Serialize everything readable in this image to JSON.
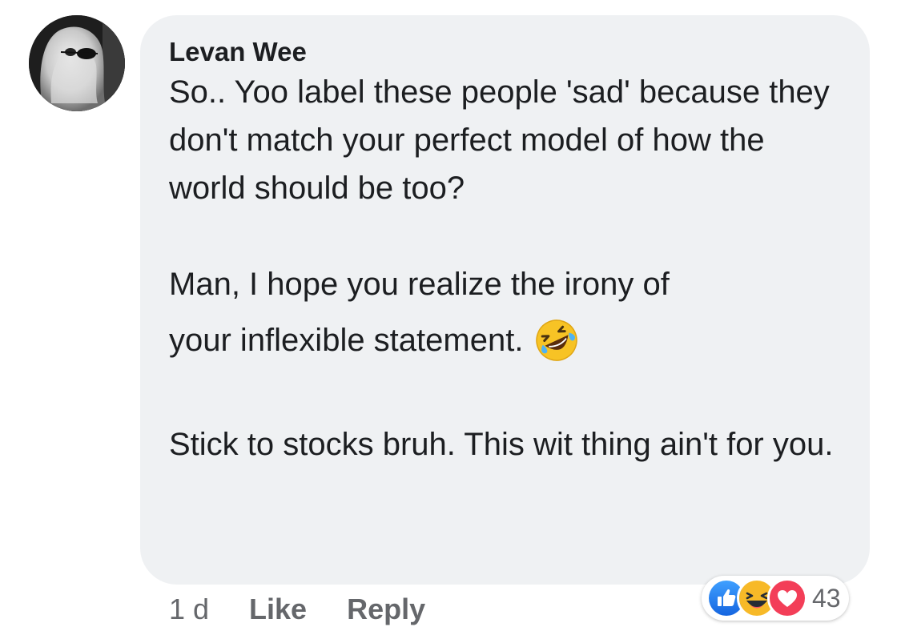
{
  "comment": {
    "author": "Levan Wee",
    "paragraphs": [
      "So.. Yoo label these people 'sad' because they don't match your perfect model of how the world should be too?",
      "Man, I hope you realize the irony of",
      "your inflexible statement.",
      "Stick to stocks bruh. This wit thing ain't for you."
    ],
    "emoji": "rolling-on-floor-laughing-icon"
  },
  "actions": {
    "time": "1 d",
    "like": "Like",
    "reply": "Reply"
  },
  "reactions": {
    "icons": [
      "like-reaction-icon",
      "haha-reaction-icon",
      "love-reaction-icon"
    ],
    "count": "43"
  },
  "colors": {
    "bubble_bg": "#eff1f3",
    "text": "#1c1e21",
    "muted": "#65676b",
    "like_blue": "#1877f2",
    "love_red": "#f33e58",
    "haha_yellow": "#f7b928"
  }
}
